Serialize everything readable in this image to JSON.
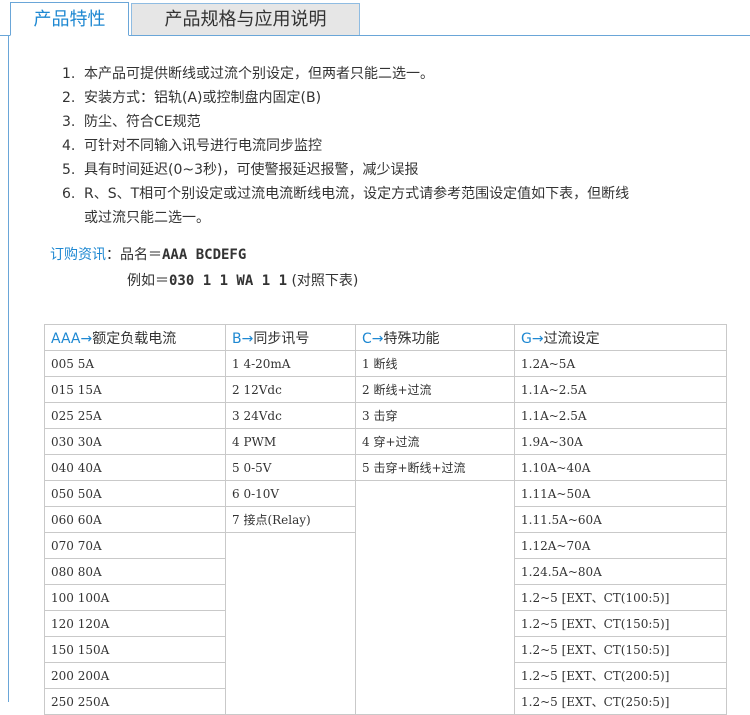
{
  "tabs": {
    "active": "产品特性",
    "inactive": "产品规格与应用说明"
  },
  "features": [
    {
      "num": "1.",
      "text": "本产品可提供断线或过流个别设定，但两者只能二选一。"
    },
    {
      "num": "2.",
      "text": "安装方式：铝轨(A)或控制盘内固定(B)"
    },
    {
      "num": "3.",
      "text": "防尘、符合CE规范"
    },
    {
      "num": "4.",
      "text": "可针对不同输入讯号进行电流同步监控"
    },
    {
      "num": "5.",
      "text": "具有时间延迟(0~3秒)，可使警报延迟报警，减少误报"
    },
    {
      "num": "6.",
      "text": "R、S、T相可个别设定或过流电流断线电流，设定方式请参考范围设定值如下表，但断线",
      "cont": "或过流只能二选一。"
    }
  ],
  "order": {
    "label": "订购资讯",
    "sep": "：品名＝",
    "model": "AAA BCDEFG",
    "example_label": "例如＝",
    "example_value": "030 1 1 WA 1 1",
    "example_note": "(对照下表)"
  },
  "table": {
    "headers": [
      {
        "key": "AAA→",
        "text": "额定负载电流"
      },
      {
        "key": "B→",
        "text": "同步讯号"
      },
      {
        "key": "C→",
        "text": "特殊功能"
      },
      {
        "key": "G→",
        "text": "过流设定"
      }
    ],
    "col_a": [
      "005 5A",
      "015 15A",
      "025 25A",
      "030 30A",
      "040 40A",
      "050 50A",
      "060 60A",
      "070 70A",
      "080 80A",
      "100 100A",
      "120 120A",
      "150 150A",
      "200 200A",
      "250 250A"
    ],
    "col_b": [
      "1 4-20mA",
      "2 12Vdc",
      "3 24Vdc",
      "4 PWM",
      "5 0-5V",
      "6 0-10V",
      "7 接点(Relay)"
    ],
    "col_c": [
      "1 断线",
      "2 断线+过流",
      "3 击穿",
      "4 穿+过流",
      "5 击穿+断线+过流"
    ],
    "col_g": [
      "1.2A~5A",
      "1.1A~2.5A",
      "1.1A~2.5A",
      "1.9A~30A",
      "1.10A~40A",
      "1.11A~50A",
      "1.11.5A~60A",
      "1.12A~70A",
      "1.24.5A~80A",
      "1.2~5 [EXT、CT(100:5)]",
      "1.2~5 [EXT、CT(150:5)]",
      "1.2~5 [EXT、CT(150:5)]",
      "1.2~5 [EXT、CT(200:5)]",
      "1.2~5 [EXT、CT(250:5)]"
    ]
  },
  "colors": {
    "accent": "#1e88d2",
    "border": "#6aa6d8",
    "inactive_tab_bg": "#e6e6e6"
  }
}
